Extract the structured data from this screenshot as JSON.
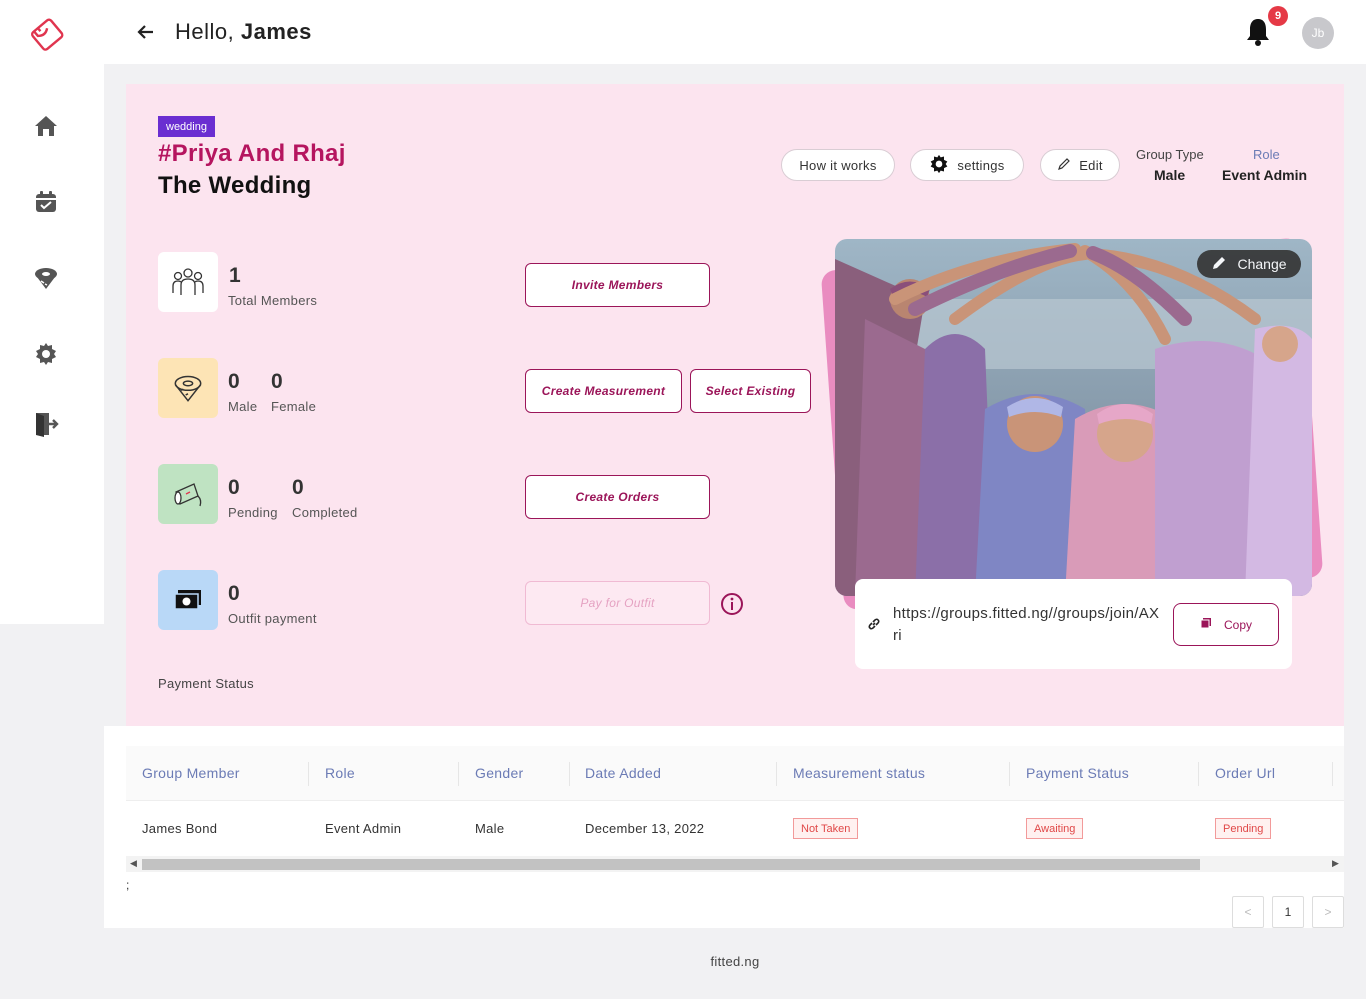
{
  "header": {
    "greeting": "Hello,",
    "user_name": "James",
    "notification_count": "9",
    "avatar_initials": "Jb"
  },
  "group": {
    "tag": "wedding",
    "title": "#Priya And Rhaj",
    "subtitle": "The Wedding",
    "how_it_works": "How it works",
    "settings": "settings",
    "edit": "Edit",
    "group_type_label": "Group Type",
    "group_type_value": "Male",
    "role_label": "Role",
    "role_value": "Event Admin"
  },
  "stats": {
    "members_count": "1",
    "members_label": "Total Members",
    "male_count": "0",
    "male_label": "Male",
    "female_count": "0",
    "female_label": "Female",
    "pending_count": "0",
    "pending_label": "Pending",
    "completed_count": "0",
    "completed_label": "Completed",
    "payment_count": "0",
    "payment_label": "Outfit payment",
    "payment_status_label": "Payment Status"
  },
  "actions": {
    "invite": "Invite Members",
    "create_measurement": "Create Measurement",
    "select_existing": "Select Existing",
    "create_orders": "Create Orders",
    "pay_outfit": "Pay for Outfit"
  },
  "photo": {
    "change": "Change",
    "invite_link": "https://groups.fitted.ng//groups/join/AXri",
    "copy": "Copy"
  },
  "table": {
    "columns": [
      "Group Member",
      "Role",
      "Gender",
      "Date Added",
      "Measurement status",
      "Payment Status",
      "Order Url"
    ],
    "rows": [
      {
        "member": "James Bond",
        "role": "Event Admin",
        "gender": "Male",
        "date": "December 13, 2022",
        "measurement": "Not Taken",
        "payment": "Awaiting",
        "order": "Pending"
      }
    ]
  },
  "misc": {
    "semicolon": ";"
  },
  "pagination": {
    "current": "1",
    "prev": "<",
    "next": ">"
  },
  "footer": {
    "text": "fitted.ng"
  },
  "colors": {
    "accent": "#b5155f",
    "tag": "#6a2ed1",
    "panel": "#fce4ef"
  }
}
